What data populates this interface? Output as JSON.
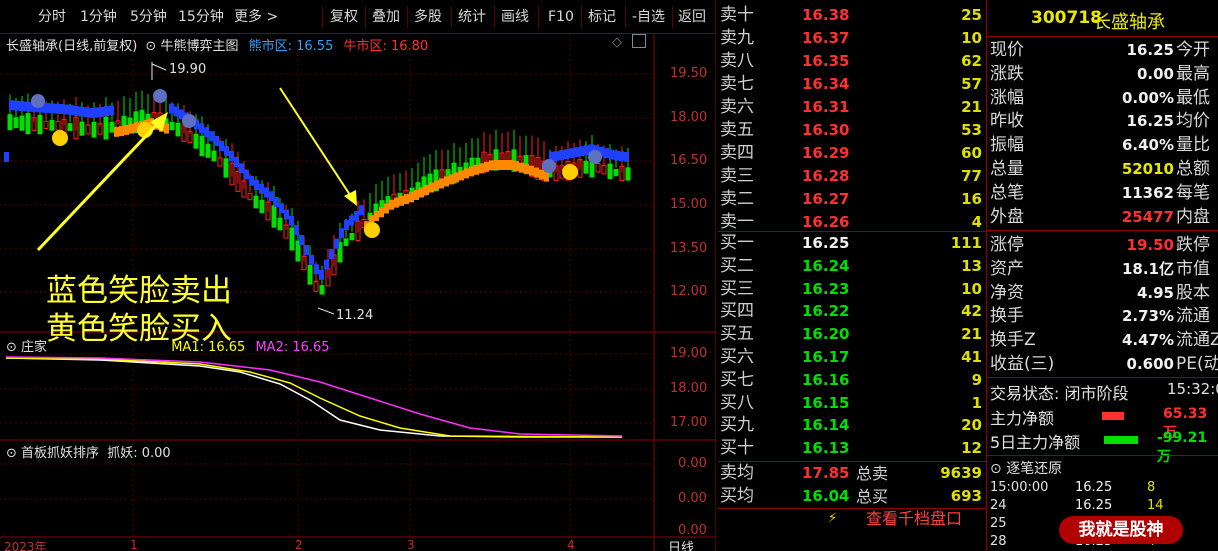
{
  "toolbar": {
    "items": [
      "分时",
      "1分钟",
      "5分钟",
      "15分钟",
      "更多 >",
      "复权",
      "叠加",
      "多股",
      "统计",
      "画线",
      "F10",
      "标记",
      "-自选",
      "返回"
    ]
  },
  "main_chart": {
    "title": "长盛轴承(日线,前复权)",
    "indicator_name": "牛熊博弈主图",
    "bear_zone_label": "熊市区: 16.55",
    "bull_zone_label": "牛市区: 16.80",
    "high_label": "19.90",
    "low_label": "11.24",
    "annotation_line1": "蓝色笑脸卖出",
    "annotation_line2": "黄色笑脸买入",
    "y_ticks": [
      "19.50",
      "18.00",
      "16.50",
      "15.00",
      "13.50",
      "12.00"
    ]
  },
  "sub_chart1": {
    "title": "庄家",
    "ma1_label": "MA1: 16.65",
    "ma2_label": "MA2: 16.65",
    "y_ticks": [
      "19.00",
      "18.00",
      "17.00"
    ]
  },
  "sub_chart2": {
    "title": "首板抓妖排序",
    "value_label": "抓妖: 0.00",
    "y_ticks": [
      "0.00",
      "0.00",
      "0.00"
    ]
  },
  "x_axis": {
    "labels": [
      "2023年",
      "1",
      "2",
      "3",
      "4"
    ],
    "period_label": "日线"
  },
  "order_book": {
    "sells": [
      {
        "name": "卖十",
        "price": "16.38",
        "vol": "25"
      },
      {
        "name": "卖九",
        "price": "16.37",
        "vol": "10"
      },
      {
        "name": "卖八",
        "price": "16.35",
        "vol": "62"
      },
      {
        "name": "卖七",
        "price": "16.34",
        "vol": "57"
      },
      {
        "name": "卖六",
        "price": "16.31",
        "vol": "21"
      },
      {
        "name": "卖五",
        "price": "16.30",
        "vol": "53"
      },
      {
        "name": "卖四",
        "price": "16.29",
        "vol": "60"
      },
      {
        "name": "卖三",
        "price": "16.28",
        "vol": "77"
      },
      {
        "name": "卖二",
        "price": "16.27",
        "vol": "16"
      },
      {
        "name": "卖一",
        "price": "16.26",
        "vol": "4"
      }
    ],
    "buys": [
      {
        "name": "买一",
        "price": "16.25",
        "vol": "111"
      },
      {
        "name": "买二",
        "price": "16.24",
        "vol": "13"
      },
      {
        "name": "买三",
        "price": "16.23",
        "vol": "10"
      },
      {
        "name": "买四",
        "price": "16.22",
        "vol": "42"
      },
      {
        "name": "买五",
        "price": "16.20",
        "vol": "21"
      },
      {
        "name": "买六",
        "price": "16.17",
        "vol": "41"
      },
      {
        "name": "买七",
        "price": "16.16",
        "vol": "9"
      },
      {
        "name": "买八",
        "price": "16.15",
        "vol": "1"
      },
      {
        "name": "买九",
        "price": "16.14",
        "vol": "20"
      },
      {
        "name": "买十",
        "price": "16.13",
        "vol": "12"
      }
    ],
    "avg_sell_label": "卖均",
    "avg_sell_price": "17.85",
    "total_sell_label": "总卖",
    "total_sell": "9639",
    "avg_buy_label": "买均",
    "avg_buy_price": "16.04",
    "total_buy_label": "总买",
    "total_buy": "693",
    "view_depth_label": "查看千档盘口"
  },
  "quote": {
    "code": "300718",
    "name": "长盛轴承",
    "rows": [
      {
        "label": "现价",
        "value": "16.25",
        "label2": "今开",
        "color": "white"
      },
      {
        "label": "涨跌",
        "value": "0.00",
        "label2": "最高",
        "color": "white"
      },
      {
        "label": "涨幅",
        "value": "0.00%",
        "label2": "最低",
        "color": "white"
      },
      {
        "label": "昨收",
        "value": "16.25",
        "label2": "均价",
        "color": "white"
      },
      {
        "label": "振幅",
        "value": "6.40%",
        "label2": "量比",
        "color": "white"
      },
      {
        "label": "总量",
        "value": "52010",
        "label2": "总额",
        "color": "yellow"
      },
      {
        "label": "总笔",
        "value": "11362",
        "label2": "每笔",
        "color": "white"
      },
      {
        "label": "外盘",
        "value": "25477",
        "label2": "内盘",
        "color": "red"
      },
      {
        "label": "涨停",
        "value": "19.50",
        "label2": "跌停",
        "color": "red"
      },
      {
        "label": "资产",
        "value": "18.1亿",
        "label2": "市值",
        "color": "white"
      },
      {
        "label": "净资",
        "value": "4.95",
        "label2": "股本",
        "color": "white"
      },
      {
        "label": "换手",
        "value": "2.73%",
        "label2": "流通",
        "color": "white"
      },
      {
        "label": "换手Z",
        "value": "4.47%",
        "label2": "流通Z",
        "color": "white"
      },
      {
        "label": "收益(三)",
        "value": "0.600",
        "label2": "PE(动)",
        "color": "white"
      }
    ],
    "trade_status_label": "交易状态: 闭市阶段",
    "trade_time": "15:32:0",
    "main_net_label": "主力净额",
    "main_net_value": "65.33万",
    "main_net5_label": "5日主力净额",
    "main_net5_value": "-99.21万",
    "tick_title": "逐笔还原",
    "ticks": [
      {
        "time": "15:00:00",
        "price": "16.25",
        "vol": "8"
      },
      {
        "time": "24",
        "price": "16.25",
        "vol": "14"
      },
      {
        "time": "25",
        "price": "16.25",
        "vol": "1"
      },
      {
        "time": "28",
        "price": "16.25",
        "vol": "4"
      }
    ],
    "watermark": "我就是股神"
  },
  "colors": {
    "up": "#ff3030",
    "down": "#00e000",
    "blue_band": "#2040ff",
    "orange_band": "#ff8800",
    "magenta": "#ff30ff"
  }
}
